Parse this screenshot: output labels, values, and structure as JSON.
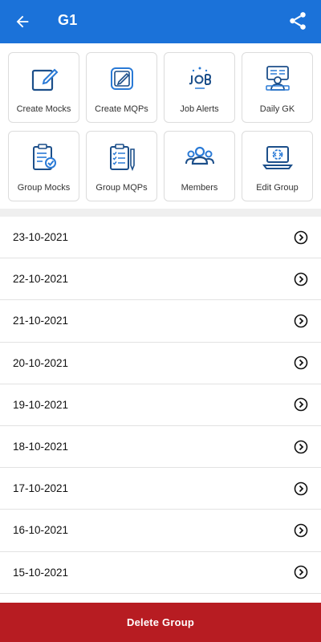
{
  "header": {
    "title": "G1",
    "back_icon": "arrow-left-icon",
    "share_icon": "share-icon",
    "background": "#1b72d9"
  },
  "tiles": [
    {
      "label": "Create Mocks",
      "icon": "edit-square-icon"
    },
    {
      "label": "Create MQPs",
      "icon": "edit-document-icon"
    },
    {
      "label": "Job Alerts",
      "icon": "job-alert-icon"
    },
    {
      "label": "Daily GK",
      "icon": "daily-gk-icon"
    },
    {
      "label": "Group Mocks",
      "icon": "clipboard-check-icon"
    },
    {
      "label": "Group MQPs",
      "icon": "clipboard-list-icon"
    },
    {
      "label": "Members",
      "icon": "members-icon"
    },
    {
      "label": "Edit Group",
      "icon": "edit-group-icon"
    }
  ],
  "dates": [
    {
      "label": "23-10-2021"
    },
    {
      "label": "22-10-2021"
    },
    {
      "label": "21-10-2021"
    },
    {
      "label": "20-10-2021"
    },
    {
      "label": "19-10-2021"
    },
    {
      "label": "18-10-2021"
    },
    {
      "label": "17-10-2021"
    },
    {
      "label": "16-10-2021"
    },
    {
      "label": "15-10-2021"
    }
  ],
  "footer": {
    "delete_label": "Delete Group",
    "color": "#b71c22"
  }
}
